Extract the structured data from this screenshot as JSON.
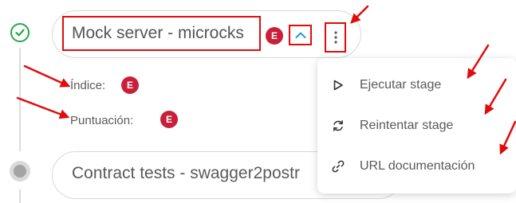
{
  "stages": [
    {
      "status": "success",
      "title": "Mock server - microcks",
      "badge": "E",
      "details": [
        {
          "label": "Índice:",
          "badge": "E"
        },
        {
          "label": "Puntuación:",
          "badge": "E"
        }
      ]
    },
    {
      "status": "pending",
      "title": "Contract tests - swagger2postr"
    }
  ],
  "menu": {
    "items": [
      {
        "icon": "play-icon",
        "label": "Ejecutar stage"
      },
      {
        "icon": "refresh-icon",
        "label": "Reintentar stage"
      },
      {
        "icon": "link-icon",
        "label": "URL documentación"
      }
    ]
  },
  "colors": {
    "success": "#27a745",
    "badge": "#c8203a",
    "highlight": "#e10b0b",
    "accent": "#1a9fd8",
    "pending": "#a4a4a4"
  }
}
